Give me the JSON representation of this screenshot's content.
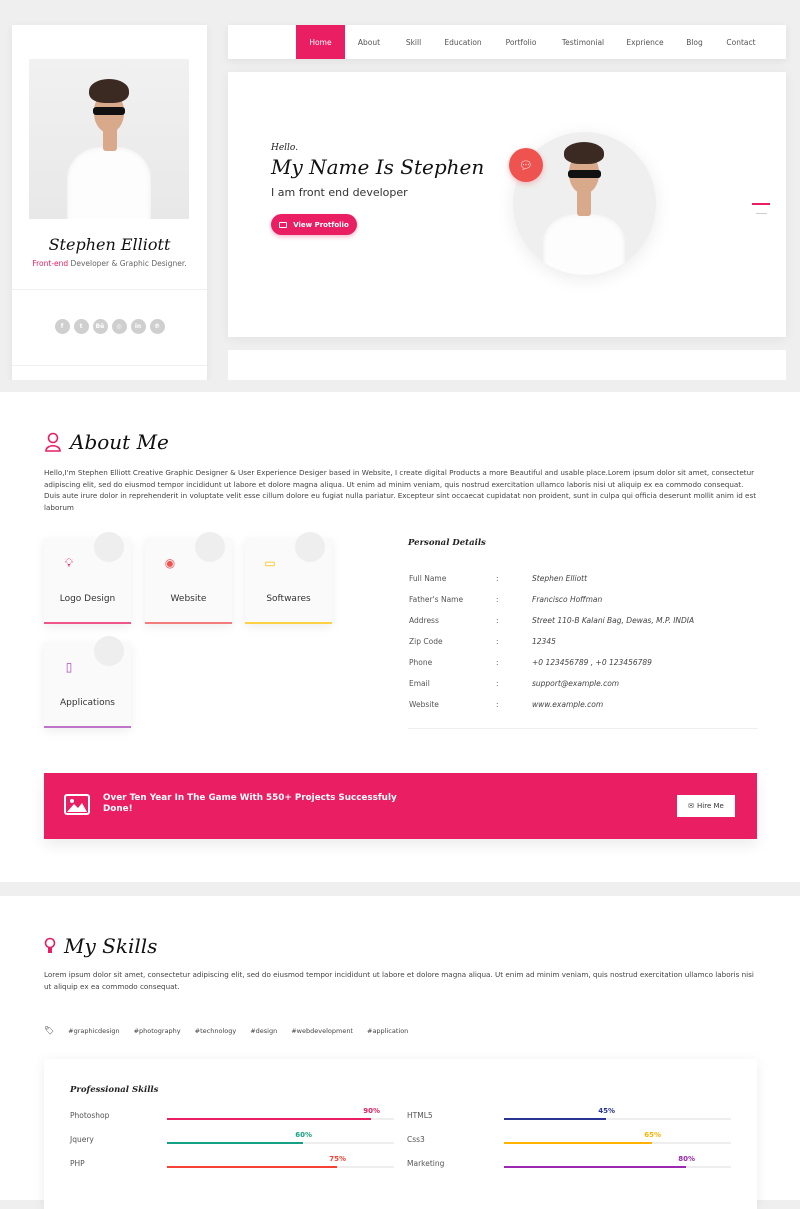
{
  "profile": {
    "name": "Stephen Elliott",
    "role_highlight": "Front-end",
    "role_rest": " Developer & Graphic Designer.",
    "socials": [
      {
        "icon": "facebook-icon",
        "glyph": "f"
      },
      {
        "icon": "twitter-icon",
        "glyph": "t"
      },
      {
        "icon": "behance-icon",
        "glyph": "Bē"
      },
      {
        "icon": "instagram-icon",
        "glyph": "◎"
      },
      {
        "icon": "linkedin-icon",
        "glyph": "in"
      },
      {
        "icon": "pinterest-icon",
        "glyph": "℗"
      }
    ]
  },
  "nav": {
    "items": [
      "Home",
      "About",
      "Skill",
      "Education",
      "Portfolio",
      "Testimonial",
      "Exprience",
      "Blog",
      "Contact"
    ],
    "active": "Home"
  },
  "hero": {
    "greeting": "Hello.",
    "title": "My Name Is Stephen",
    "subtitle": "I am front end developer",
    "button_label": "View Protfolio"
  },
  "about": {
    "title": "About Me",
    "text": "Hello,I'm Stephen Elliott Creative Graphic Designer & User Experience Desiger based in Website, I create digital Products a more Beautiful and usable place.Lorem ipsum dolor sit amet, consectetur adipiscing elit, sed do eiusmod tempor incididunt ut labore et dolore magna aliqua. Ut enim ad minim veniam, quis nostrud exercitation ullamco laboris nisi ut aliquip ex ea commodo consequat. Duis aute irure dolor in reprehenderit in voluptate velit esse cillum dolore eu fugiat nulla pariatur. Excepteur sint occaecat cupidatat non proident, sunt in culpa qui officia deserunt mollit anim id est laborum",
    "services": [
      {
        "label": "Logo Design",
        "icon": "lightbulb-icon",
        "color": "#e91e63"
      },
      {
        "label": "Website",
        "icon": "globe-icon",
        "color": "#ef5350"
      },
      {
        "label": "Softwares",
        "icon": "monitor-icon",
        "color": "#ffc107"
      },
      {
        "label": "Applications",
        "icon": "mobile-icon",
        "color": "#ab47bc"
      }
    ],
    "personal_details_title": "Personal Details",
    "personal_details": [
      {
        "key": "Full Name",
        "value": "Stephen Elliott"
      },
      {
        "key": "Father's Name",
        "value": "Francisco Hoffman"
      },
      {
        "key": "Address",
        "value": "Street 110-B Kalani Bag, Dewas, M.P. INDIA"
      },
      {
        "key": "Zip Code",
        "value": "12345"
      },
      {
        "key": "Phone",
        "value": "+0 123456789 , +0 123456789"
      },
      {
        "key": "Email",
        "value": "support@example.com"
      },
      {
        "key": "Website",
        "value": "www.example.com"
      }
    ],
    "separator": ":",
    "banner_text": "Over Ten Year In The Game With 550+ Projects Successfuly Done!",
    "hire_label": "Hire Me"
  },
  "skills": {
    "title": "My Skills",
    "text": "Lorem ipsum dolor sit amet, consectetur adipiscing elit, sed do eiusmod tempor incididunt ut labore et dolore magna aliqua. Ut enim ad minim veniam, quis nostrud exercitation ullamco laboris nisi ut aliquip ex ea commodo consequat.",
    "tags": [
      "#graphicdesign",
      "#photography",
      "#technology",
      "#design",
      "#webdevelopment",
      "#application"
    ],
    "professional_title": "Professional Skills",
    "items": [
      {
        "name": "Photoshop",
        "percent": 90,
        "label": "90%",
        "color": "#e91e63"
      },
      {
        "name": "Jquery",
        "percent": 60,
        "label": "60%",
        "color": "#16a085"
      },
      {
        "name": "PHP",
        "percent": 75,
        "label": "75%",
        "color": "#f44336"
      },
      {
        "name": "HTML5",
        "percent": 45,
        "label": "45%",
        "color": "#283593"
      },
      {
        "name": "Css3",
        "percent": 65,
        "label": "65%",
        "color": "#ffb300"
      },
      {
        "name": "Marketing",
        "percent": 80,
        "label": "80%",
        "color": "#9c27b0"
      }
    ]
  },
  "colors": {
    "accent": "#e91e63"
  }
}
